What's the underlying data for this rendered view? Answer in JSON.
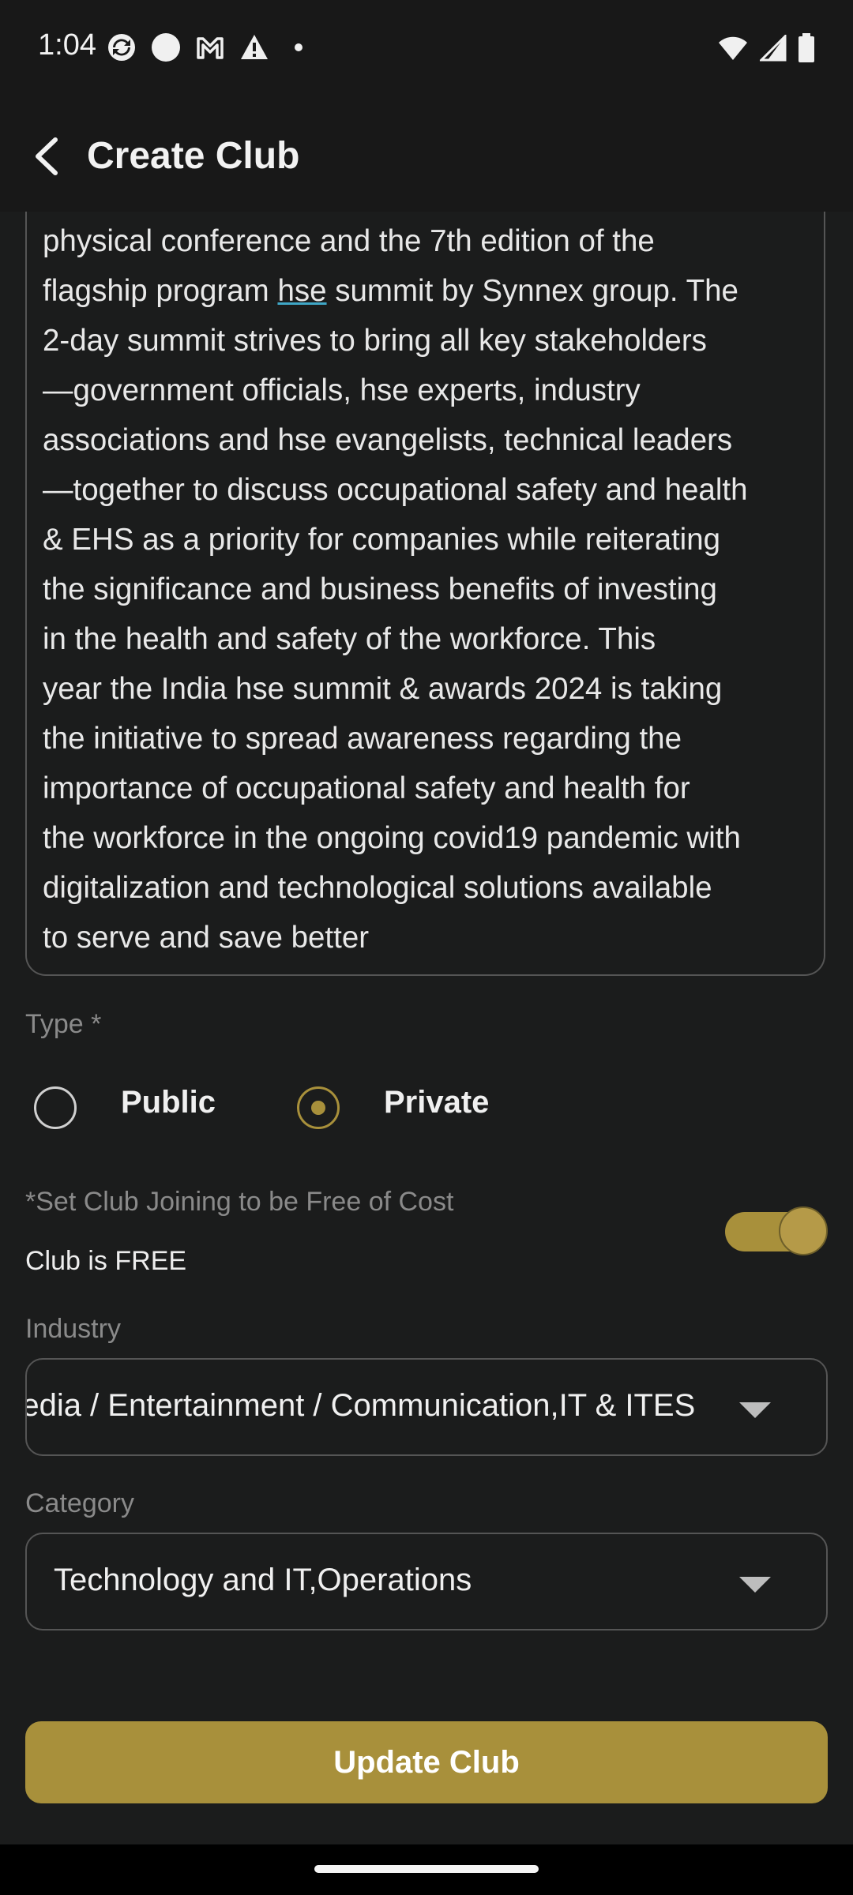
{
  "status_bar": {
    "time": "1:04",
    "icons": [
      "sync-icon",
      "circle-icon",
      "gmail-icon",
      "warning-icon",
      "dot-icon"
    ],
    "right_icons": [
      "wifi-icon",
      "signal-icon",
      "battery-icon"
    ]
  },
  "app_bar": {
    "title": "Create Club",
    "back_icon": "back-arrow-icon"
  },
  "description": {
    "text_before": "physical conference and the 7th edition of the\nflagship program ",
    "underlined_word": "hse",
    "text_after": " summit by Synnex group. The\n2-day summit strives to bring all key stakeholders\n—government officials, hse experts, industry\nassociations and hse evangelists, technical leaders\n—together to discuss occupational safety and health\n& EHS as a priority for companies while reiterating\nthe significance and business benefits of investing\nin the health and safety of the workforce. This\nyear the India hse summit & awards 2024 is taking\nthe initiative to spread awareness regarding the\nimportance of occupational safety and health for\nthe workforce in the ongoing covid19 pandemic with\ndigitalization and technological solutions available\nto serve and save better"
  },
  "type": {
    "label": "Type *",
    "options": [
      {
        "label": "Public",
        "selected": false
      },
      {
        "label": "Private",
        "selected": true
      }
    ]
  },
  "pricing": {
    "note": "*Set Club Joining to be Free of Cost",
    "status": "Club is FREE",
    "toggle_on": true
  },
  "industry": {
    "label": "Industry",
    "value": "Media / Entertainment / Communication,IT & ITES"
  },
  "category": {
    "label": "Category",
    "value": "Technology and IT,Operations"
  },
  "submit": {
    "label": "Update Club"
  },
  "colors": {
    "accent": "#a8903b",
    "background": "#1b1c1c",
    "border": "#555555"
  }
}
